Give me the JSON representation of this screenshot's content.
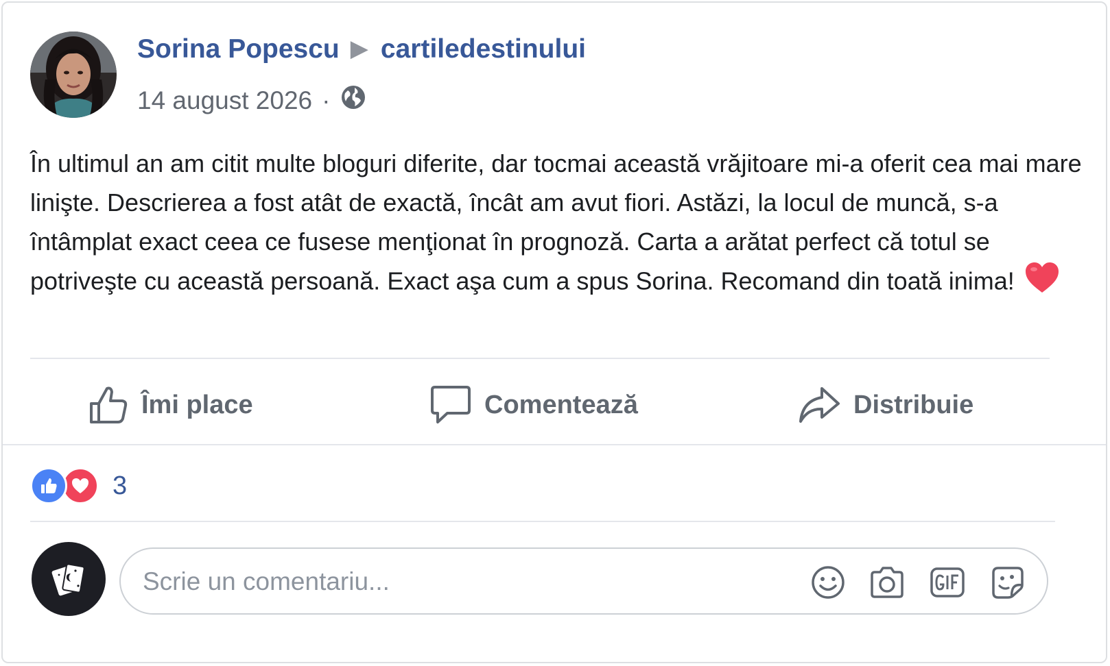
{
  "post": {
    "author": "Sorina Popescu",
    "arrow": "▶",
    "page": "cartiledestinului",
    "date": "14 august 2026",
    "separator": "·",
    "privacy_icon": "globe-icon",
    "text": "În ultimul an am citit multe bloguri diferite, dar tocmai această vrăjitoare mi-a oferit cea mai mare linişte. Descrierea a fost atât de exactă, încât am avut fiori. Astăzi, la locul de muncă, s-a întâmplat exact ceea ce fusese menţionat în prognoză. Carta a arătat perfect că totul se potriveşte cu această persoană. Exact aşa cum a spus Sorina. Recomand din toată inima!",
    "emoji_icon": "red-heart-icon"
  },
  "actions": {
    "like_label": "Îmi place",
    "comment_label": "Comentează",
    "share_label": "Distribuie"
  },
  "reactions": {
    "types": [
      "like-icon",
      "love-icon"
    ],
    "count": "3"
  },
  "comment": {
    "placeholder": "Scrie un comentariu...",
    "tools": [
      "emoji-icon",
      "camera-icon",
      "gif-icon",
      "sticker-icon"
    ]
  },
  "colors": {
    "link": "#385898",
    "like_blue": "#4a82f5",
    "love_red": "#f0435a",
    "muted": "#606770"
  }
}
